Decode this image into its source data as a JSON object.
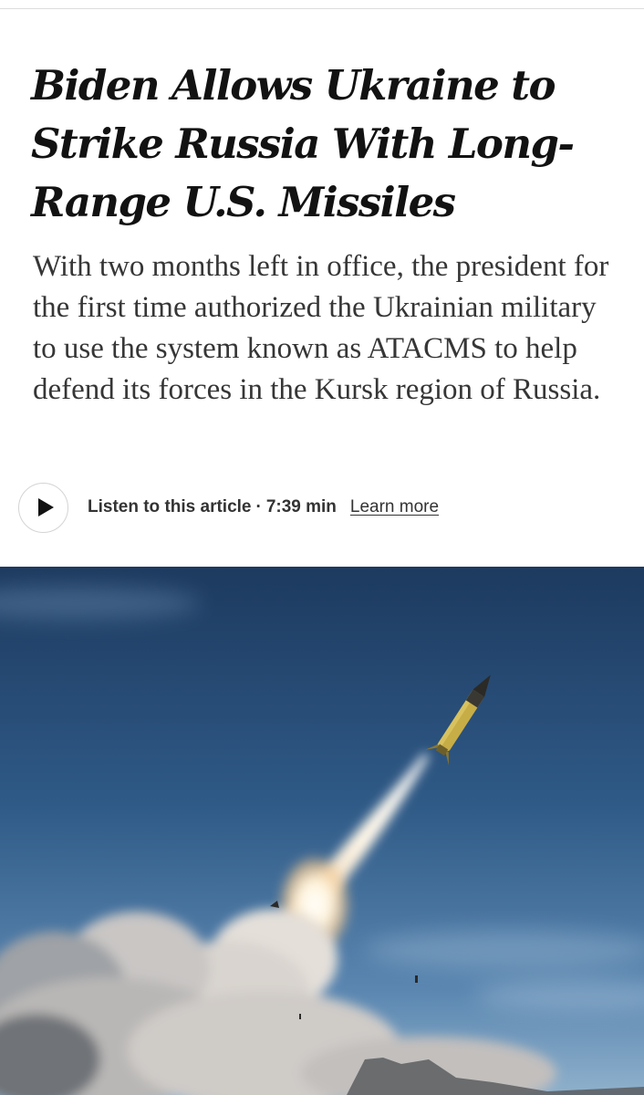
{
  "article": {
    "headline": "Biden Allows Ukraine to Strike Russia With Long-Range U.S. Missiles",
    "summary": "With two months left in office, the president for the first time authorized the Ukrainian military to use the system known as ATACMS to help defend its forces in the Kursk region of Russia."
  },
  "audio": {
    "play_icon": "play-icon",
    "label": "Listen to this article",
    "separator": "·",
    "duration": "7:39 min",
    "learn_more": "Learn more"
  },
  "photo": {
    "subject": "missile-launch-photo",
    "colors": {
      "sky_top": "#1e3f66",
      "sky_bottom": "#5c88b4",
      "smoke": "#d8d6d4",
      "missile_body": "#c9b04a",
      "flame": "#fff3d6"
    }
  }
}
